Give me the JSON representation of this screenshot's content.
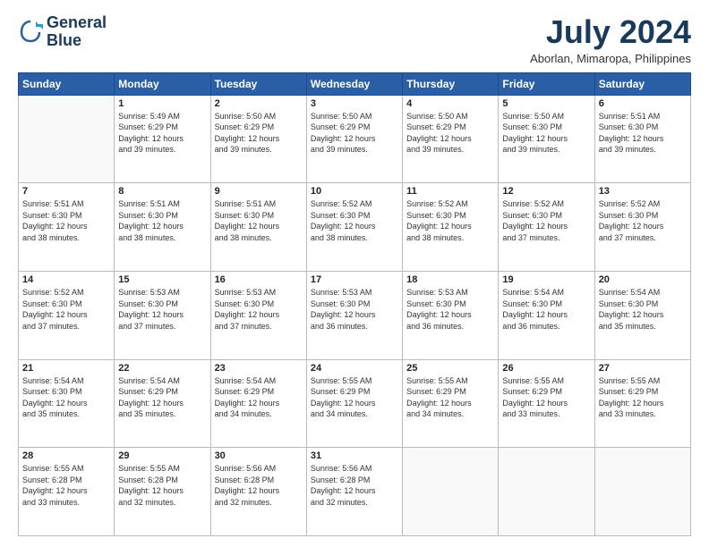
{
  "logo": {
    "line1": "General",
    "line2": "Blue"
  },
  "title": "July 2024",
  "location": "Aborlan, Mimaropa, Philippines",
  "days_header": [
    "Sunday",
    "Monday",
    "Tuesday",
    "Wednesday",
    "Thursday",
    "Friday",
    "Saturday"
  ],
  "weeks": [
    [
      {
        "day": "",
        "info": ""
      },
      {
        "day": "1",
        "info": "Sunrise: 5:49 AM\nSunset: 6:29 PM\nDaylight: 12 hours\nand 39 minutes."
      },
      {
        "day": "2",
        "info": "Sunrise: 5:50 AM\nSunset: 6:29 PM\nDaylight: 12 hours\nand 39 minutes."
      },
      {
        "day": "3",
        "info": "Sunrise: 5:50 AM\nSunset: 6:29 PM\nDaylight: 12 hours\nand 39 minutes."
      },
      {
        "day": "4",
        "info": "Sunrise: 5:50 AM\nSunset: 6:29 PM\nDaylight: 12 hours\nand 39 minutes."
      },
      {
        "day": "5",
        "info": "Sunrise: 5:50 AM\nSunset: 6:30 PM\nDaylight: 12 hours\nand 39 minutes."
      },
      {
        "day": "6",
        "info": "Sunrise: 5:51 AM\nSunset: 6:30 PM\nDaylight: 12 hours\nand 39 minutes."
      }
    ],
    [
      {
        "day": "7",
        "info": "Sunrise: 5:51 AM\nSunset: 6:30 PM\nDaylight: 12 hours\nand 38 minutes."
      },
      {
        "day": "8",
        "info": "Sunrise: 5:51 AM\nSunset: 6:30 PM\nDaylight: 12 hours\nand 38 minutes."
      },
      {
        "day": "9",
        "info": "Sunrise: 5:51 AM\nSunset: 6:30 PM\nDaylight: 12 hours\nand 38 minutes."
      },
      {
        "day": "10",
        "info": "Sunrise: 5:52 AM\nSunset: 6:30 PM\nDaylight: 12 hours\nand 38 minutes."
      },
      {
        "day": "11",
        "info": "Sunrise: 5:52 AM\nSunset: 6:30 PM\nDaylight: 12 hours\nand 38 minutes."
      },
      {
        "day": "12",
        "info": "Sunrise: 5:52 AM\nSunset: 6:30 PM\nDaylight: 12 hours\nand 37 minutes."
      },
      {
        "day": "13",
        "info": "Sunrise: 5:52 AM\nSunset: 6:30 PM\nDaylight: 12 hours\nand 37 minutes."
      }
    ],
    [
      {
        "day": "14",
        "info": "Sunrise: 5:52 AM\nSunset: 6:30 PM\nDaylight: 12 hours\nand 37 minutes."
      },
      {
        "day": "15",
        "info": "Sunrise: 5:53 AM\nSunset: 6:30 PM\nDaylight: 12 hours\nand 37 minutes."
      },
      {
        "day": "16",
        "info": "Sunrise: 5:53 AM\nSunset: 6:30 PM\nDaylight: 12 hours\nand 37 minutes."
      },
      {
        "day": "17",
        "info": "Sunrise: 5:53 AM\nSunset: 6:30 PM\nDaylight: 12 hours\nand 36 minutes."
      },
      {
        "day": "18",
        "info": "Sunrise: 5:53 AM\nSunset: 6:30 PM\nDaylight: 12 hours\nand 36 minutes."
      },
      {
        "day": "19",
        "info": "Sunrise: 5:54 AM\nSunset: 6:30 PM\nDaylight: 12 hours\nand 36 minutes."
      },
      {
        "day": "20",
        "info": "Sunrise: 5:54 AM\nSunset: 6:30 PM\nDaylight: 12 hours\nand 35 minutes."
      }
    ],
    [
      {
        "day": "21",
        "info": "Sunrise: 5:54 AM\nSunset: 6:30 PM\nDaylight: 12 hours\nand 35 minutes."
      },
      {
        "day": "22",
        "info": "Sunrise: 5:54 AM\nSunset: 6:29 PM\nDaylight: 12 hours\nand 35 minutes."
      },
      {
        "day": "23",
        "info": "Sunrise: 5:54 AM\nSunset: 6:29 PM\nDaylight: 12 hours\nand 34 minutes."
      },
      {
        "day": "24",
        "info": "Sunrise: 5:55 AM\nSunset: 6:29 PM\nDaylight: 12 hours\nand 34 minutes."
      },
      {
        "day": "25",
        "info": "Sunrise: 5:55 AM\nSunset: 6:29 PM\nDaylight: 12 hours\nand 34 minutes."
      },
      {
        "day": "26",
        "info": "Sunrise: 5:55 AM\nSunset: 6:29 PM\nDaylight: 12 hours\nand 33 minutes."
      },
      {
        "day": "27",
        "info": "Sunrise: 5:55 AM\nSunset: 6:29 PM\nDaylight: 12 hours\nand 33 minutes."
      }
    ],
    [
      {
        "day": "28",
        "info": "Sunrise: 5:55 AM\nSunset: 6:28 PM\nDaylight: 12 hours\nand 33 minutes."
      },
      {
        "day": "29",
        "info": "Sunrise: 5:55 AM\nSunset: 6:28 PM\nDaylight: 12 hours\nand 32 minutes."
      },
      {
        "day": "30",
        "info": "Sunrise: 5:56 AM\nSunset: 6:28 PM\nDaylight: 12 hours\nand 32 minutes."
      },
      {
        "day": "31",
        "info": "Sunrise: 5:56 AM\nSunset: 6:28 PM\nDaylight: 12 hours\nand 32 minutes."
      },
      {
        "day": "",
        "info": ""
      },
      {
        "day": "",
        "info": ""
      },
      {
        "day": "",
        "info": ""
      }
    ]
  ]
}
